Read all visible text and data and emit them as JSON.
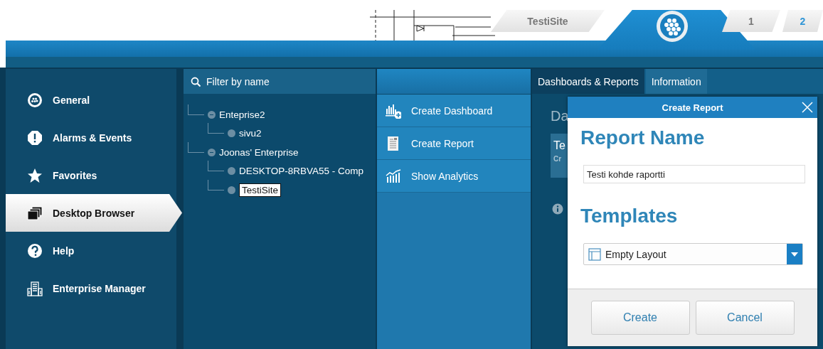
{
  "header": {
    "tabs": [
      {
        "label": "TestiSite",
        "selected": false
      },
      {
        "label": "1",
        "selected": false
      },
      {
        "label": "2",
        "selected": true
      }
    ]
  },
  "sidebar": {
    "items": [
      {
        "label": "General",
        "selected": false
      },
      {
        "label": "Alarms & Events",
        "selected": false
      },
      {
        "label": "Favorites",
        "selected": false
      },
      {
        "label": "Desktop Browser",
        "selected": true
      },
      {
        "label": "Help",
        "selected": false
      },
      {
        "label": "Enterprise Manager",
        "selected": false
      }
    ]
  },
  "tree": {
    "filter": {
      "placeholder": "Filter by name"
    },
    "items": [
      {
        "label": "Enteprise2",
        "expanded": true,
        "selected": false,
        "children": [
          {
            "label": "sivu2",
            "selected": false
          }
        ]
      },
      {
        "label": "Joonas' Enterprise",
        "expanded": true,
        "selected": false,
        "children": [
          {
            "label": "DESKTOP-8RBVA55 - Comp",
            "selected": false
          },
          {
            "label": "TestiSite",
            "selected": true
          }
        ]
      }
    ]
  },
  "actions": [
    {
      "label": "Create Dashboard"
    },
    {
      "label": "Create Report"
    },
    {
      "label": "Show Analytics"
    }
  ],
  "content": {
    "tabs": [
      {
        "label": "Dashboards & Reports",
        "selected": true
      },
      {
        "label": "Information",
        "selected": false
      }
    ],
    "heading": "Da",
    "card_title": "Te",
    "card_subtitle": "Cr"
  },
  "dialog": {
    "title": "Create Report",
    "name_label": "Report Name",
    "name_value": "Testi kohde raportti",
    "templates_label": "Templates",
    "template": "Empty Layout",
    "buttons": [
      "Create",
      "Cancel"
    ]
  }
}
